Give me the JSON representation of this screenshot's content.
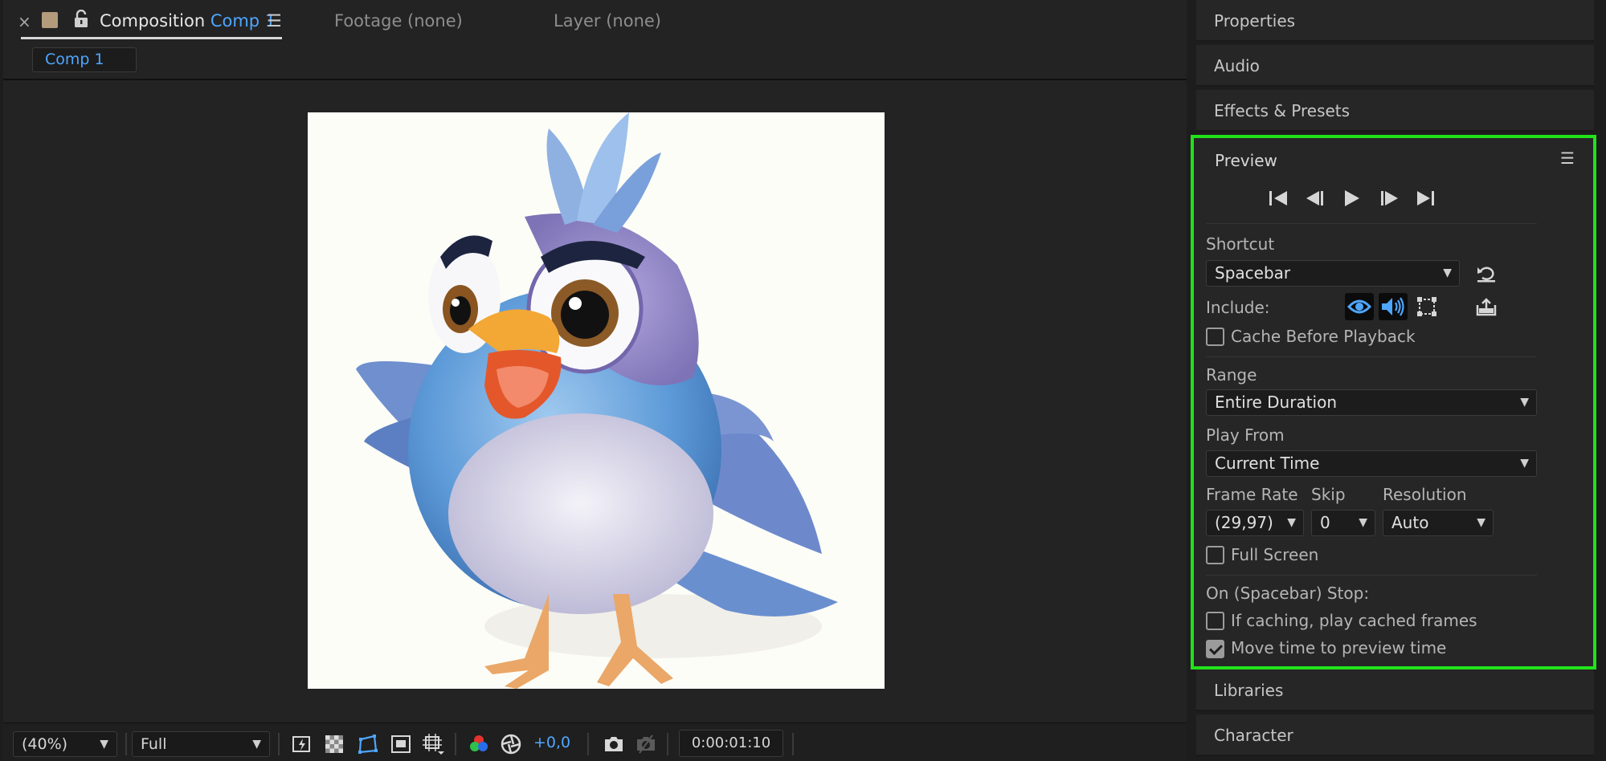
{
  "composition_panel": {
    "close_glyph": "×",
    "title_prefix": "Composition",
    "title_comp": "Comp 1",
    "menu_glyph": "☰",
    "footage_tab": "Footage (none)",
    "layer_tab": "Layer (none)",
    "breadcrumb": "Comp 1",
    "swatch_color": "#b39b7b"
  },
  "viewer_toolbar": {
    "magnification": "(40%)",
    "resolution": "Full",
    "exposure": "+0,0",
    "timecode": "0:00:01:10",
    "accent_color": "#4ea6ff"
  },
  "right_panels": {
    "properties": "Properties",
    "audio": "Audio",
    "effects": "Effects & Presets",
    "libraries": "Libraries",
    "character": "Character"
  },
  "preview": {
    "title": "Preview",
    "menu_glyph": "☰",
    "shortcut_label": "Shortcut",
    "shortcut_value": "Spacebar",
    "include_label": "Include:",
    "cache_before_playback": "Cache Before Playback",
    "cache_before_playback_checked": false,
    "range_label": "Range",
    "range_value": "Entire Duration",
    "play_from_label": "Play From",
    "play_from_value": "Current Time",
    "frame_rate_label": "Frame Rate",
    "frame_rate_value": "(29,97)",
    "skip_label": "Skip",
    "skip_value": "0",
    "resolution_label": "Resolution",
    "resolution_value": "Auto",
    "full_screen": "Full Screen",
    "full_screen_checked": false,
    "stop_label": "On (Spacebar) Stop:",
    "if_caching": "If caching, play cached frames",
    "if_caching_checked": false,
    "move_time": "Move time to preview time",
    "move_time_checked": true,
    "highlight_color": "#22e21a"
  }
}
